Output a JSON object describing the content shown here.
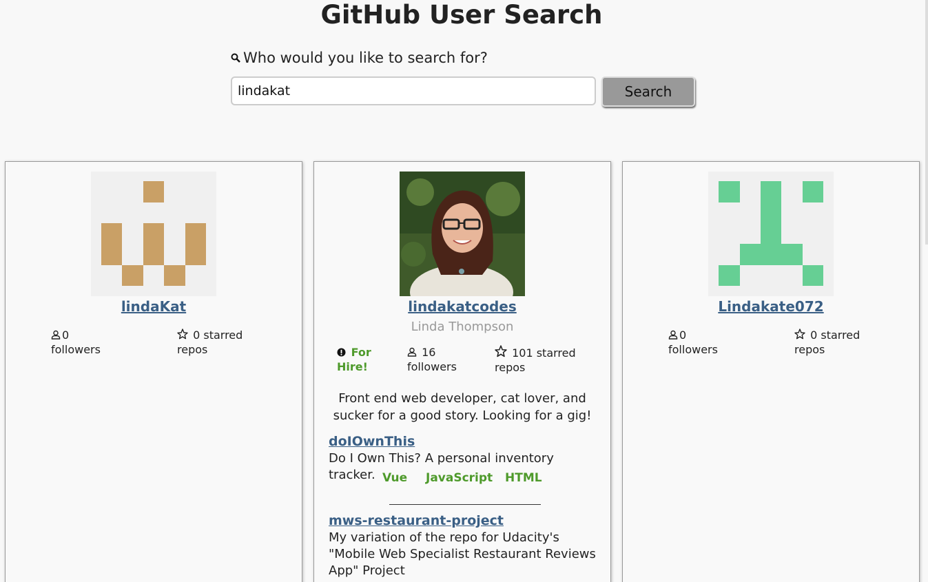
{
  "header": {
    "title": "GitHub User Search"
  },
  "search": {
    "label": "Who would you like to search for?",
    "value": "lindakat",
    "button_label": "Search"
  },
  "results": [
    {
      "login": "lindaKat",
      "followers_count": "0",
      "followers_label": "followers",
      "starred_count": "0 starred",
      "starred_label": "repos",
      "avatar_color": "#c9a066"
    },
    {
      "login": "lindakatcodes",
      "name": "Linda Thompson",
      "hire_line1": "For",
      "hire_line2": "Hire!",
      "followers_count": "16",
      "followers_label": "followers",
      "starred_count": "101 starred",
      "starred_label": "repos",
      "bio_line1": "Front end web developer, cat lover, and",
      "bio_line2": "sucker for a good story. Looking for a gig!",
      "repos": [
        {
          "name": "doIOwnThis",
          "description": "Do I Own This? A personal inventory tracker.",
          "languages": [
            "Vue",
            "JavaScript",
            "HTML"
          ]
        },
        {
          "name": "mws-restaurant-project",
          "description_line1": "My variation of the repo for Udacity's",
          "description_line2": "\"Mobile Web Specialist Restaurant Reviews",
          "description_line3": "App\" Project"
        }
      ]
    },
    {
      "login": "Lindakate072",
      "followers_count": "0",
      "followers_label": "followers",
      "starred_count": "0 starred",
      "starred_label": "repos",
      "avatar_color": "#66cf94"
    }
  ],
  "icons": {
    "search": "magnifier-icon",
    "followers": "user-icon",
    "starred": "star-icon",
    "hire": "alert-circle-icon"
  },
  "colors": {
    "link": "#3a5f85",
    "language": "#4e9a2b",
    "hire": "#4e9a2b",
    "button": "#999999",
    "background": "#f8f8f8"
  }
}
